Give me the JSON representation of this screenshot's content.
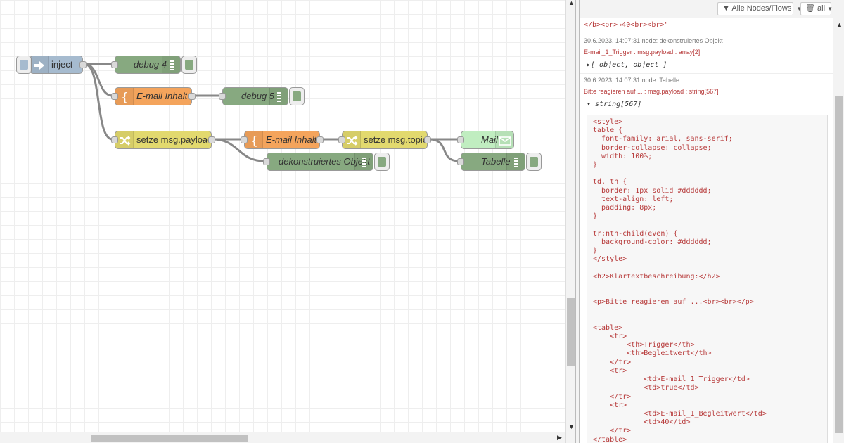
{
  "workspace": {
    "nodes": {
      "inject": {
        "label": "inject",
        "color": "#a6bbcf"
      },
      "debug4": {
        "label": "debug 4",
        "color": "#87a980"
      },
      "email1": {
        "label": "E-mail Inhalt",
        "color": "#f4a45c"
      },
      "debug5": {
        "label": "debug 5",
        "color": "#87a980"
      },
      "setze_payload": {
        "label": "setze msg.payload",
        "color": "#e2d96e"
      },
      "email2": {
        "label": "E-mail Inhalt",
        "color": "#f4a45c"
      },
      "setze_topic": {
        "label": "setze msg.topic",
        "color": "#e2d96e"
      },
      "mail": {
        "label": "Mail",
        "color": "#c0edc0"
      },
      "dekon": {
        "label": "dekonstruiertes Objekt",
        "color": "#87a980"
      },
      "tabelle": {
        "label": "Tabelle",
        "color": "#87a980"
      }
    }
  },
  "sidebar": {
    "filter_label": "Alle Nodes/Flows",
    "clear_label": "all",
    "messages": [
      {
        "value": "</b><br>→40<br><br>\""
      },
      {
        "meta": "30.6.2023, 14:07:31   node: dekonstruiertes Objekt",
        "topic": "E-mail_1_Trigger : msg.payload : array[2]",
        "value": "▸[ object, object ]"
      },
      {
        "meta": "30.6.2023, 14:07:31   node: Tabelle",
        "topic": "Bitte reagieren auf ... : msg.payload : string[567]",
        "value": "▾ string[567]"
      }
    ],
    "code": "<style>\ntable {\n  font-family: arial, sans-serif;\n  border-collapse: collapse;\n  width: 100%;\n}\n\ntd, th {\n  border: 1px solid #dddddd;\n  text-align: left;\n  padding: 8px;\n}\n\ntr:nth-child(even) {\n  background-color: #dddddd;\n}\n</style>\n\n<h2>Klartextbeschreibung:</h2>\n\n\n<p>Bitte reagieren auf ...<br><br></p>\n\n\n<table>\n    <tr>\n        <th>Trigger</th>\n        <th>Begleitwert</th>\n    </tr>\n    <tr>\n            <td>E-mail_1_Trigger</td>\n            <td>true</td>\n    </tr>\n    <tr>\n            <td>E-mail_1_Begleitwert</td>\n            <td>40</td>\n    </tr>\n</table>"
  }
}
